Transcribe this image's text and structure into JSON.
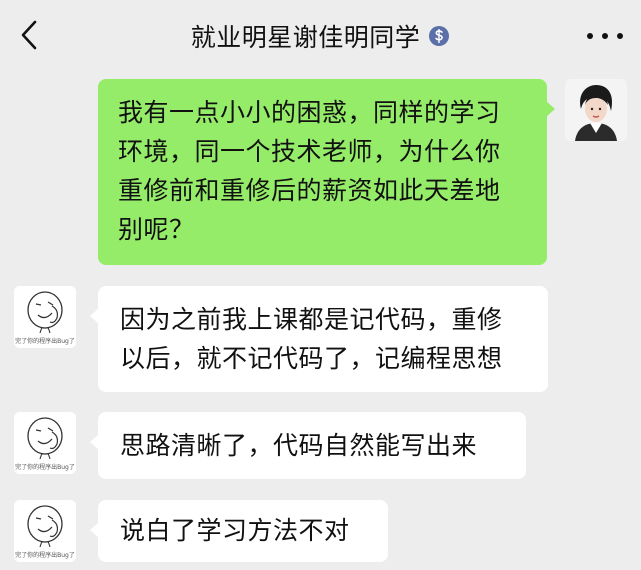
{
  "header": {
    "title": "就业明星谢佳明同学"
  },
  "messages": [
    {
      "side": "right",
      "text_lines": [
        "我有一点小小的困惑，同样的学习",
        "环境，同一个技术老师，为什么你",
        "重修前和重修后的薪资如此天差地",
        "别呢？"
      ]
    },
    {
      "side": "left",
      "text_lines": [
        "因为之前我上课都是记代码，重修",
        "以后，就不记代码了，记编程思想"
      ]
    },
    {
      "side": "left",
      "text_lines": [
        "思路清晰了，代码自然能写出来"
      ]
    },
    {
      "side": "left",
      "text_lines": [
        "说白了学习方法不对"
      ]
    }
  ],
  "avatar_caption": "完了你的程序出Bug了",
  "colors": {
    "background": "#ededed",
    "sent_bubble": "#95ec69",
    "received_bubble": "#ffffff",
    "badge": "#5b6fa8"
  },
  "icons": {
    "back": "chevron-left-icon",
    "badge": "dollar-badge-icon",
    "more": "more-dots-icon"
  }
}
